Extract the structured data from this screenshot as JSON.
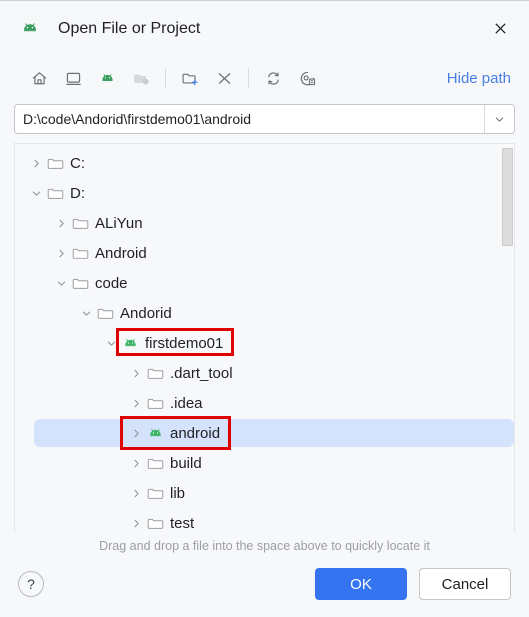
{
  "window": {
    "title": "Open File or Project",
    "app_icon": "android-icon",
    "close_icon": "close-icon"
  },
  "toolbar": {
    "buttons": [
      {
        "name": "home-icon",
        "label": "Home",
        "disabled": false
      },
      {
        "name": "desktop-icon",
        "label": "Desktop",
        "disabled": false
      },
      {
        "name": "project-android-icon",
        "label": "Project Directory",
        "disabled": false
      },
      {
        "name": "folder-icon",
        "label": "Recent",
        "disabled": true
      }
    ],
    "buttons2": [
      {
        "name": "new-folder-icon",
        "label": "New Folder",
        "disabled": false
      },
      {
        "name": "delete-icon",
        "label": "Delete",
        "disabled": false
      }
    ],
    "buttons3": [
      {
        "name": "refresh-icon",
        "label": "Refresh",
        "disabled": false
      },
      {
        "name": "show-hidden-icon",
        "label": "Show Hidden Files",
        "disabled": false
      }
    ],
    "hide_path_label": "Hide path"
  },
  "path": {
    "value": "D:\\code\\Andorid\\firstdemo01\\android",
    "placeholder": "",
    "dropdown_icon": "chevron-down-icon"
  },
  "tree": {
    "rows": [
      {
        "label": "C:",
        "indent": 0,
        "twisty": "collapsed",
        "icon": "folder-icon",
        "selected": false,
        "highlight": "none"
      },
      {
        "label": "D:",
        "indent": 0,
        "twisty": "expanded",
        "icon": "folder-icon",
        "selected": false,
        "highlight": "none"
      },
      {
        "label": "ALiYun",
        "indent": 1,
        "twisty": "collapsed",
        "icon": "folder-icon",
        "selected": false,
        "highlight": "none"
      },
      {
        "label": "Android",
        "indent": 1,
        "twisty": "collapsed",
        "icon": "folder-icon",
        "selected": false,
        "highlight": "none"
      },
      {
        "label": "code",
        "indent": 1,
        "twisty": "expanded",
        "icon": "folder-icon",
        "selected": false,
        "highlight": "none"
      },
      {
        "label": "Andorid",
        "indent": 2,
        "twisty": "expanded",
        "icon": "folder-icon",
        "selected": false,
        "highlight": "none"
      },
      {
        "label": "firstdemo01",
        "indent": 3,
        "twisty": "expanded",
        "icon": "android-icon",
        "selected": false,
        "highlight": "red-box-label"
      },
      {
        "label": ".dart_tool",
        "indent": 4,
        "twisty": "collapsed",
        "icon": "folder-icon",
        "selected": false,
        "highlight": "none"
      },
      {
        "label": ".idea",
        "indent": 4,
        "twisty": "collapsed",
        "icon": "folder-icon",
        "selected": false,
        "highlight": "none"
      },
      {
        "label": "android",
        "indent": 4,
        "twisty": "collapsed",
        "icon": "android-icon",
        "selected": true,
        "highlight": "red-box-row"
      },
      {
        "label": "build",
        "indent": 4,
        "twisty": "collapsed",
        "icon": "folder-icon",
        "selected": false,
        "highlight": "none"
      },
      {
        "label": "lib",
        "indent": 4,
        "twisty": "collapsed",
        "icon": "folder-icon",
        "selected": false,
        "highlight": "none"
      },
      {
        "label": "test",
        "indent": 4,
        "twisty": "collapsed",
        "icon": "folder-icon",
        "selected": false,
        "highlight": "none"
      }
    ],
    "scrollbar": {
      "name": "vertical-scrollbar"
    }
  },
  "hint": {
    "text": "Drag and drop a file into the space above to quickly locate it"
  },
  "footer": {
    "help_label": "?",
    "ok_label": "OK",
    "cancel_label": "Cancel"
  },
  "colors": {
    "accent_blue": "#3574f0",
    "link_blue": "#4a7fe0",
    "selection_blue": "#d4e2fc",
    "annotation_red": "#e00000",
    "android_green": "#3ddc84",
    "background": "#f7f8fa"
  }
}
